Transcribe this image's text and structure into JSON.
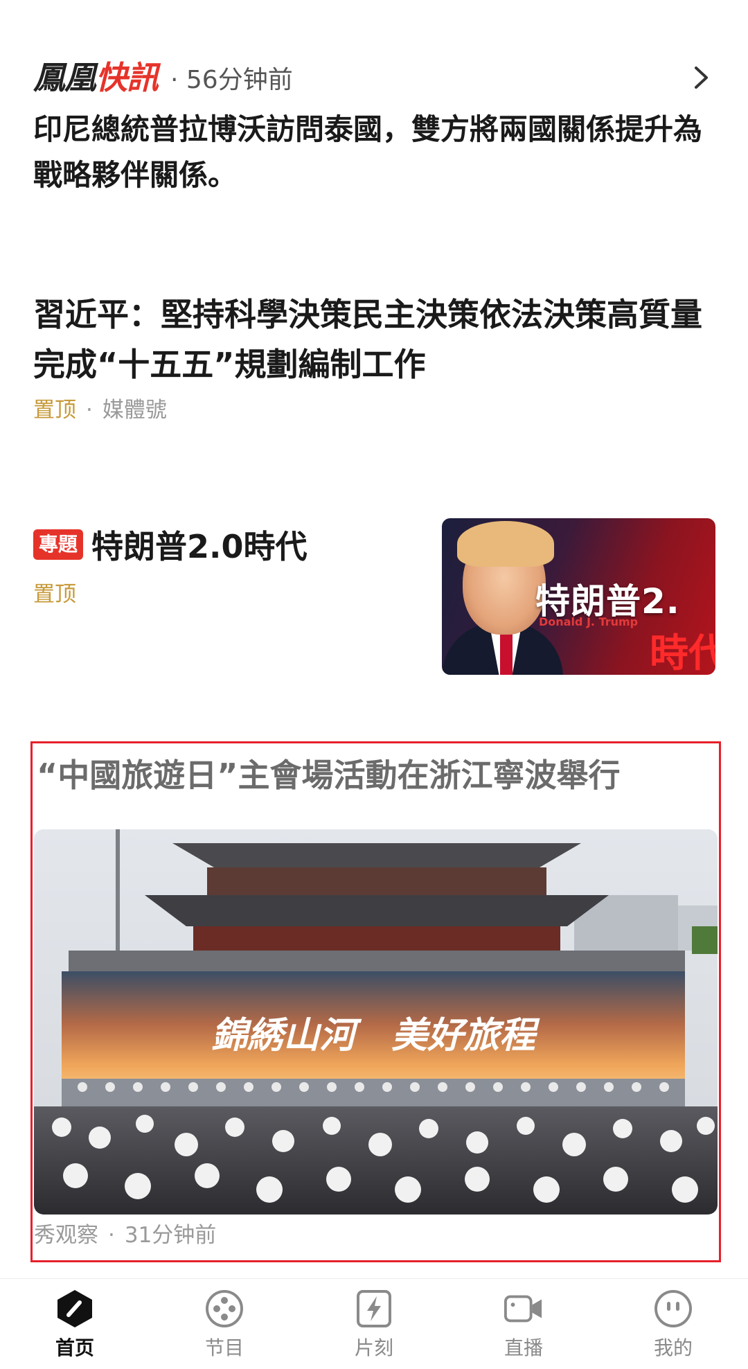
{
  "flash": {
    "logo_part1": "鳳凰",
    "logo_part2": "快訊",
    "time": "· 56分钟前",
    "text": "印尼總統普拉博沃訪問泰國，雙方將兩國關係提升為戰略夥伴關係。"
  },
  "article1": {
    "title": "習近平：堅持科學決策民主決策依法決策高質量完成“十五五”規劃編制工作",
    "pin": "置顶",
    "dot": "·",
    "source": "媒體號"
  },
  "topic": {
    "badge": "專題",
    "title": "特朗普2.0時代",
    "pin": "置顶",
    "thumb_title": "特朗普2.",
    "thumb_sub": "Donald J. Trump",
    "thumb_red": "時代"
  },
  "highlight": {
    "title": "“中國旅遊日”主會場活動在浙江寧波舉行",
    "banner_text": "錦綉山河　美好旅程",
    "source": "秀观察",
    "dot": "·",
    "time": "31分钟前",
    "border_color": "#e6202a"
  },
  "tabbar": {
    "tabs": [
      {
        "label": "首页",
        "icon": "home-icon",
        "active": true
      },
      {
        "label": "节目",
        "icon": "film-reel-icon",
        "active": false
      },
      {
        "label": "片刻",
        "icon": "lightning-icon",
        "active": false
      },
      {
        "label": "直播",
        "icon": "video-camera-icon",
        "active": false
      },
      {
        "label": "我的",
        "icon": "profile-face-icon",
        "active": false
      }
    ]
  },
  "colors": {
    "brand_red": "#e6332a",
    "pin_gold": "#c79a3a",
    "meta_gray": "#999999"
  }
}
